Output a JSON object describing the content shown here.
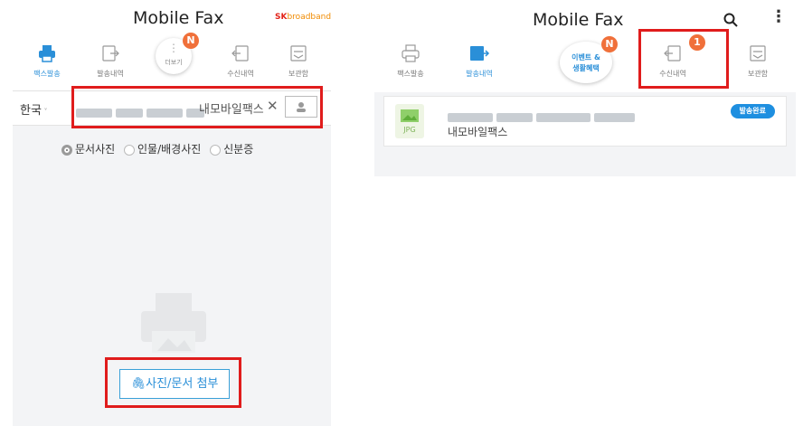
{
  "left": {
    "app_title": "Mobile Fax",
    "brand": {
      "sk": "SK",
      "broadband": "broadband"
    },
    "tabs": [
      {
        "label": "팩스발송",
        "active": true,
        "icon": "printer-icon"
      },
      {
        "label": "발송내역",
        "active": false,
        "icon": "sent-history-icon"
      },
      {
        "label": "더보기",
        "active": false,
        "icon": "more-icon"
      },
      {
        "label": "수신내역",
        "active": false,
        "icon": "inbox-icon"
      },
      {
        "label": "보관함",
        "active": false,
        "icon": "storage-icon"
      }
    ],
    "more_badge": "N",
    "country": "한국",
    "recipient_name": "내모바일팩스",
    "clear_glyph": "✕",
    "options": [
      {
        "label": "문서사진",
        "selected": true
      },
      {
        "label": "인물/배경사진",
        "selected": false
      },
      {
        "label": "신분증",
        "selected": false
      }
    ],
    "attach_button": "사진/문서 첨부"
  },
  "right": {
    "app_title": "Mobile Fax",
    "tabs": [
      {
        "label": "팩스발송",
        "active": false,
        "icon": "printer-icon"
      },
      {
        "label": "발송내역",
        "active": true,
        "icon": "sent-history-icon"
      },
      {
        "label": "수신내역",
        "active": false,
        "icon": "inbox-icon"
      },
      {
        "label": "보관함",
        "active": false,
        "icon": "storage-icon"
      }
    ],
    "event_button": {
      "line1": "이벤트 &",
      "line2": "생활혜택",
      "badge": "N"
    },
    "inbox_badge": "1",
    "item": {
      "thumb_label": "JPG",
      "recipient": "내모바일팩스",
      "status": "발송완료"
    }
  },
  "colors": {
    "accent": "#2a8fd8",
    "badge": "#f0703a",
    "highlight": "#e01c1c"
  }
}
